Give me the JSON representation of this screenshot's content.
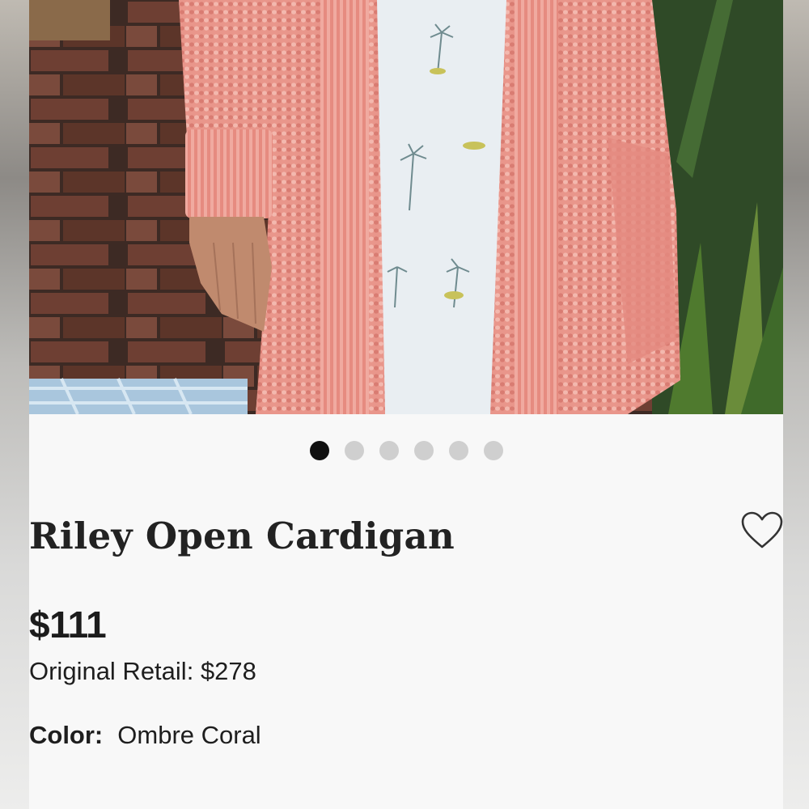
{
  "carousel": {
    "slide_count": 6,
    "active_index": 0
  },
  "product": {
    "title": "Riley Open Cardigan",
    "price": "$111",
    "original_retail_label": "Original Retail:",
    "original_retail_value": "$278",
    "color_label": "Color:",
    "color_value": "Ombre Coral"
  },
  "icons": {
    "favorite": "heart-outline-icon"
  },
  "colors": {
    "background": "#f8f8f8",
    "dot_active": "#111111",
    "dot_inactive": "#cfcfcf",
    "text": "#1e1e1e",
    "cardigan": "#e8958a"
  }
}
